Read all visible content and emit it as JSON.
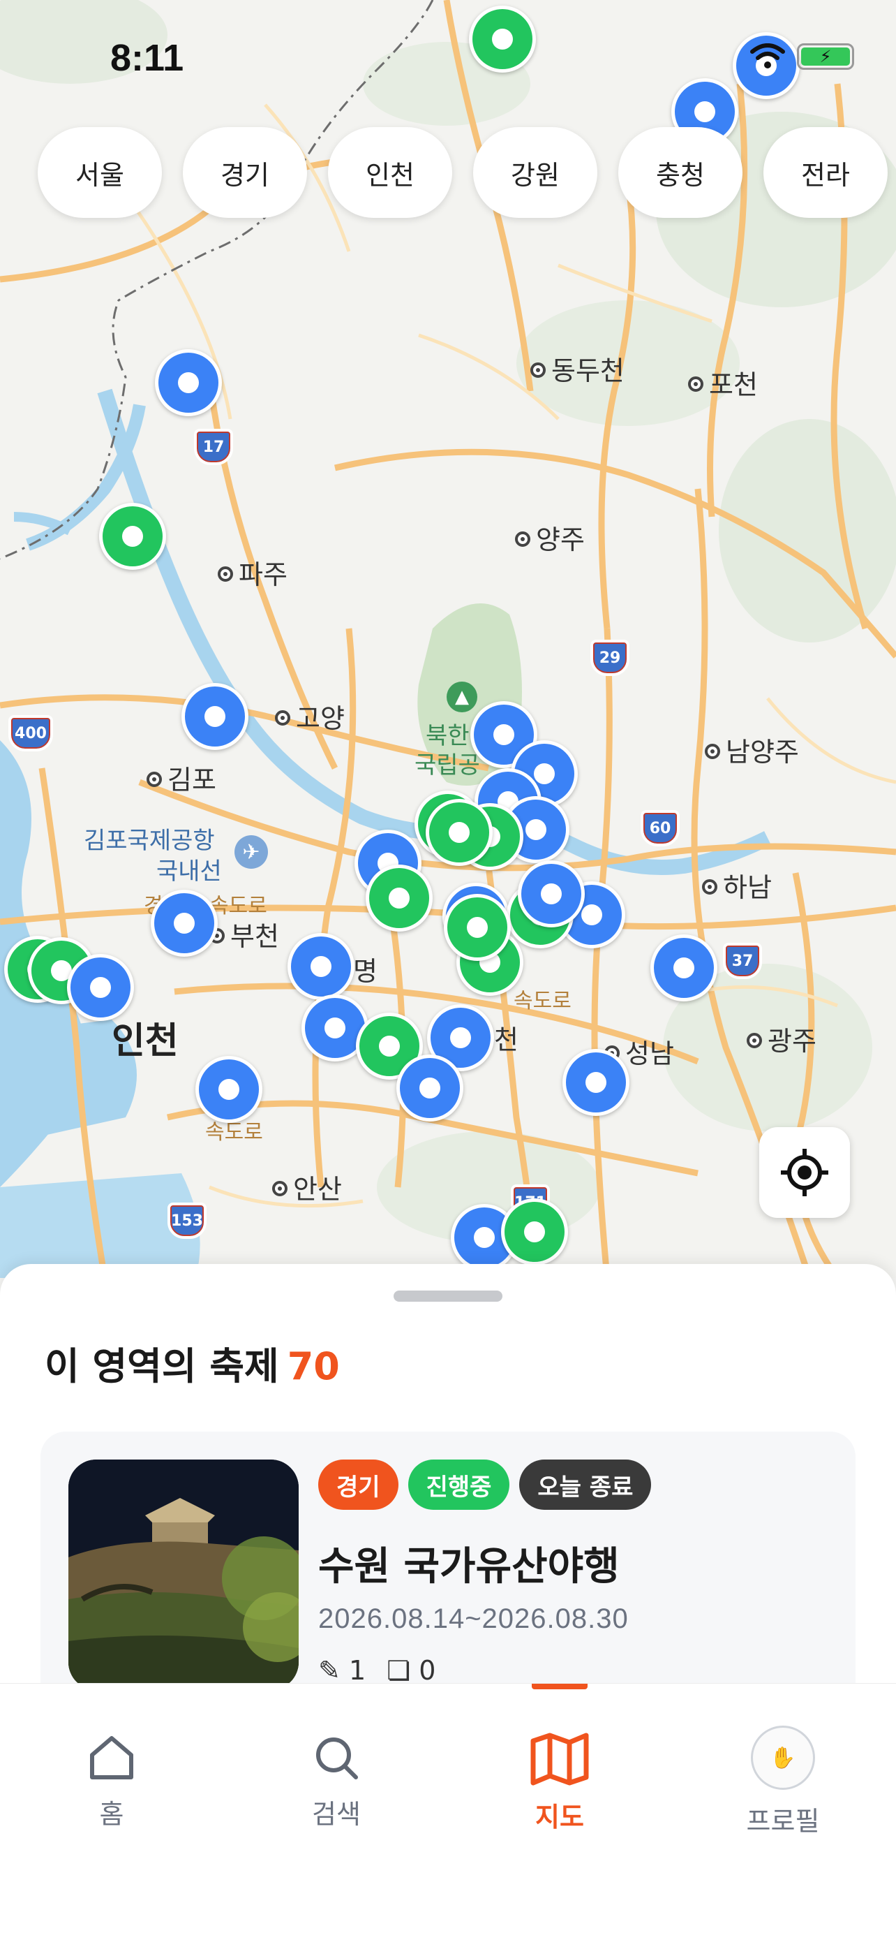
{
  "status_bar": {
    "time": "8:11"
  },
  "regions": [
    "서울",
    "경기",
    "인천",
    "강원",
    "충청",
    "전라"
  ],
  "map_labels": {
    "dongducheon": "동두천",
    "pocheon": "포천",
    "yangju": "양주",
    "paju": "파주",
    "goyang": "고양",
    "gimpo": "김포",
    "namyangju": "남양주",
    "hanam": "하남",
    "bucheon": "부천",
    "incheon": "인천",
    "seongnam": "성남",
    "gwangju": "광주",
    "ansan": "안산",
    "gwangmyeong": "명",
    "gwacheon": "천",
    "bukhan_line1": "북한",
    "bukhan_line2": "국립공",
    "gimpo_airport_line1": "김포국제공항",
    "gimpo_airport_line2": "국내선",
    "expressway_1": "속도로",
    "expressway_2": "속도로",
    "expressway_3": "경",
    "expressway_4": "속도로",
    "shields": [
      "17",
      "29",
      "400",
      "60",
      "37",
      "153",
      "171"
    ]
  },
  "sheet": {
    "title": "이 영역의 축제",
    "count": "70"
  },
  "festival_card": {
    "tags": {
      "region": "경기",
      "status": "진행중",
      "ending": "오늘 종료"
    },
    "title": "수원 국가유산야행",
    "dates": "2026.08.14~2026.08.30",
    "review_count": "1",
    "bookmark_count": "0"
  },
  "tabs": {
    "home": "홈",
    "search": "검색",
    "map": "지도",
    "profile": "프로필"
  },
  "colors": {
    "accent": "#f0541e",
    "pin_blue": "#3b82f6",
    "pin_green": "#22c55e"
  }
}
